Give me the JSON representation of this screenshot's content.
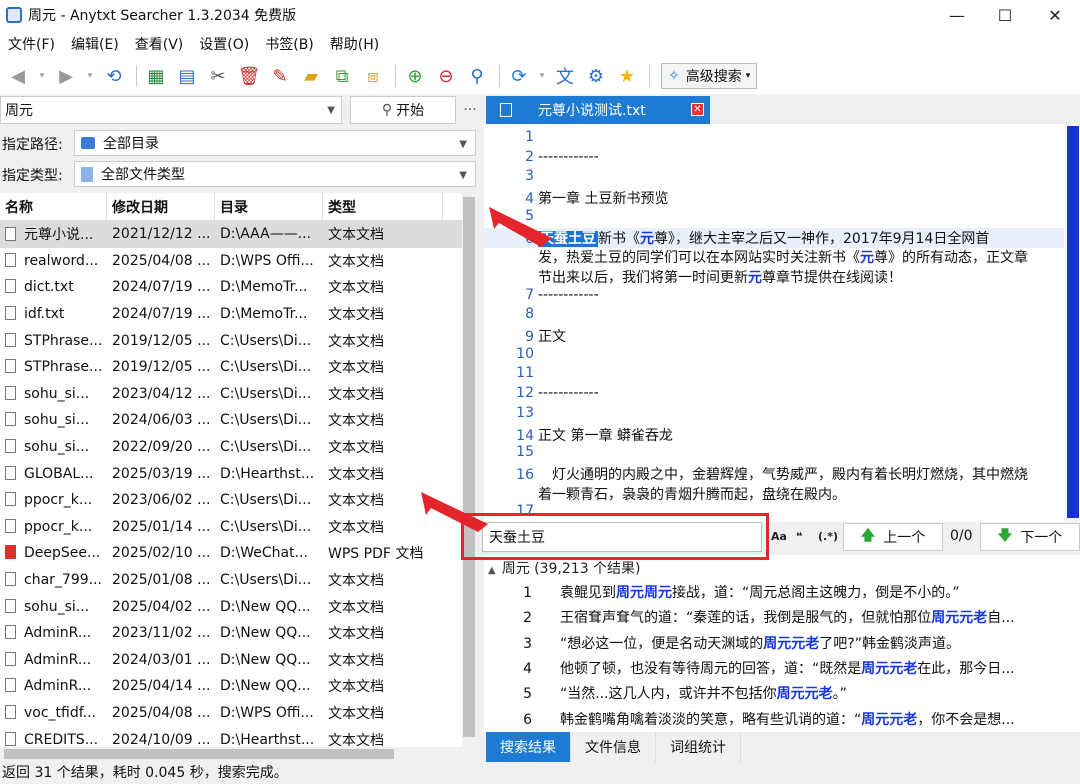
{
  "window": {
    "title": "周元 - Anytxt Searcher 1.3.2034 免费版"
  },
  "menu": [
    "文件(F)",
    "编辑(E)",
    "查看(V)",
    "设置(O)",
    "书签(B)",
    "帮助(H)"
  ],
  "toolbar": {
    "advanced_search": "高级搜索"
  },
  "search": {
    "query": "周元",
    "start_button": "开始",
    "more": "···"
  },
  "filters": {
    "path_label": "指定路径:",
    "path_value": "全部目录",
    "type_label": "指定类型:",
    "type_value": "全部文件类型"
  },
  "table": {
    "columns": [
      "名称",
      "修改日期",
      "目录",
      "类型"
    ],
    "rows": [
      {
        "name": "元尊小说...",
        "date": "2021/12/12 ...",
        "dir": "D:\\AAA——...",
        "type": "文本文档"
      },
      {
        "name": "realword...",
        "date": "2025/04/08 ...",
        "dir": "D:\\WPS Offi...",
        "type": "文本文档"
      },
      {
        "name": "dict.txt",
        "date": "2024/07/19 ...",
        "dir": "D:\\MemoTr...",
        "type": "文本文档"
      },
      {
        "name": "idf.txt",
        "date": "2024/07/19 ...",
        "dir": "D:\\MemoTr...",
        "type": "文本文档"
      },
      {
        "name": "STPhrase...",
        "date": "2019/12/05 ...",
        "dir": "C:\\Users\\Di...",
        "type": "文本文档"
      },
      {
        "name": "STPhrase...",
        "date": "2019/12/05 ...",
        "dir": "C:\\Users\\Di...",
        "type": "文本文档"
      },
      {
        "name": "sohu_si...",
        "date": "2023/04/12 ...",
        "dir": "C:\\Users\\Di...",
        "type": "文本文档"
      },
      {
        "name": "sohu_si...",
        "date": "2024/06/03 ...",
        "dir": "C:\\Users\\Di...",
        "type": "文本文档"
      },
      {
        "name": "sohu_si...",
        "date": "2022/09/20 ...",
        "dir": "C:\\Users\\Di...",
        "type": "文本文档"
      },
      {
        "name": "GLOBAL...",
        "date": "2025/03/19 ...",
        "dir": "D:\\Hearthst...",
        "type": "文本文档"
      },
      {
        "name": "ppocr_k...",
        "date": "2023/06/02 ...",
        "dir": "C:\\Users\\Di...",
        "type": "文本文档"
      },
      {
        "name": "ppocr_k...",
        "date": "2025/01/14 ...",
        "dir": "C:\\Users\\Di...",
        "type": "文本文档"
      },
      {
        "name": "DeepSee...",
        "date": "2025/02/10 ...",
        "dir": "D:\\WeChat...",
        "type": "WPS PDF 文档"
      },
      {
        "name": "char_799...",
        "date": "2025/01/08 ...",
        "dir": "C:\\Users\\Di...",
        "type": "文本文档"
      },
      {
        "name": "sohu_si...",
        "date": "2025/04/02 ...",
        "dir": "D:\\New QQ...",
        "type": "文本文档"
      },
      {
        "name": "AdminR...",
        "date": "2023/11/02 ...",
        "dir": "D:\\New QQ...",
        "type": "文本文档"
      },
      {
        "name": "AdminR...",
        "date": "2024/03/01 ...",
        "dir": "D:\\New QQ...",
        "type": "文本文档"
      },
      {
        "name": "AdminR...",
        "date": "2025/04/14 ...",
        "dir": "D:\\New QQ...",
        "type": "文本文档"
      },
      {
        "name": "voc_tfidf...",
        "date": "2025/04/08 ...",
        "dir": "D:\\WPS Offi...",
        "type": "文本文档"
      },
      {
        "name": "CREDITS...",
        "date": "2024/10/09 ...",
        "dir": "D:\\Hearthst...",
        "type": "文本文档"
      }
    ]
  },
  "preview": {
    "tab_title": "元尊小说测试.txt",
    "lines": [
      {
        "n": "1",
        "t": ""
      },
      {
        "n": "2",
        "t": "------------"
      },
      {
        "n": "3",
        "t": ""
      },
      {
        "n": "4",
        "t": "第一章 土豆新书预览"
      },
      {
        "n": "5",
        "t": ""
      },
      {
        "n": "6",
        "t_sel": "天蚕土豆",
        "t_a": "新书《",
        "t_hl": "元",
        "t_b": "尊》，继大主宰之后又一神作，2017年9月14日全网首"
      },
      {
        "n": "",
        "t_c": "发，热爱土豆的同学们可以在本网站实时关注新书《",
        "t_hl2": "元",
        "t_d": "尊》的所有动态，正文章"
      },
      {
        "n": "",
        "t_e": "节出来以后，我们将第一时间更新",
        "t_hl3": "元",
        "t_f": "尊章节提供在线阅读！"
      },
      {
        "n": "7",
        "t": "------------"
      },
      {
        "n": "8",
        "t": ""
      },
      {
        "n": "9",
        "t": "正文"
      },
      {
        "n": "10",
        "t": ""
      },
      {
        "n": "11",
        "t": ""
      },
      {
        "n": "12",
        "t": "------------"
      },
      {
        "n": "13",
        "t": ""
      },
      {
        "n": "14",
        "t": "正文 第一章 蟒雀吞龙"
      },
      {
        "n": "15",
        "t": ""
      },
      {
        "n": "16",
        "t": "灯火通明的内殿之中，金碧辉煌，气势威严，殿内有着长明灯燃烧，其中燃烧"
      },
      {
        "n": "",
        "t": "着一颗青石，袅袅的青烟升腾而起，盘绕在殿内。"
      },
      {
        "n": "17",
        "t": ""
      }
    ]
  },
  "find": {
    "value": "天蚕土豆",
    "opt_case": "Aa",
    "opt_word": "❝",
    "opt_regex": "(.*)",
    "prev": "上一个",
    "count": "0/0",
    "next": "下一个"
  },
  "results": {
    "header": "周元 (39,213 个结果)",
    "rows": [
      {
        "n": "1",
        "a": "袁鲲见到",
        "h": "周元周元",
        "b": "接战，道：“周元总阁主这魄力，倒是不小的。”"
      },
      {
        "n": "2",
        "a": "王宿耷声耷气的道：“秦莲的话，我倒是服气的，但就怕那位",
        "h": "周元元老",
        "b": "自..."
      },
      {
        "n": "3",
        "a": "“想必这一位，便是名动天渊域的",
        "h": "周元元老",
        "b": "了吧?”韩金鹤淡声道。"
      },
      {
        "n": "4",
        "a": "他顿了顿，也没有等待周元的回答，道：“既然是",
        "h": "周元元老",
        "b": "在此，那今日..."
      },
      {
        "n": "5",
        "a": "“当然...这几人内，或许并不包括你",
        "h": "周元元老",
        "b": "。”"
      },
      {
        "n": "6",
        "a": "韩金鹤嘴角噙着淡淡的笑意，略有些讥诮的道：“",
        "h": "周元元老",
        "b": "，你不会是想..."
      }
    ]
  },
  "bottom_tabs": [
    "搜索结果",
    "文件信息",
    "词组统计"
  ],
  "status": "返回 31 个结果，耗时 0.045 秒，搜索完成。",
  "colors": {
    "accent": "#1e7bd4",
    "highlight": "#1536e0",
    "annotation": "#e2262b"
  }
}
